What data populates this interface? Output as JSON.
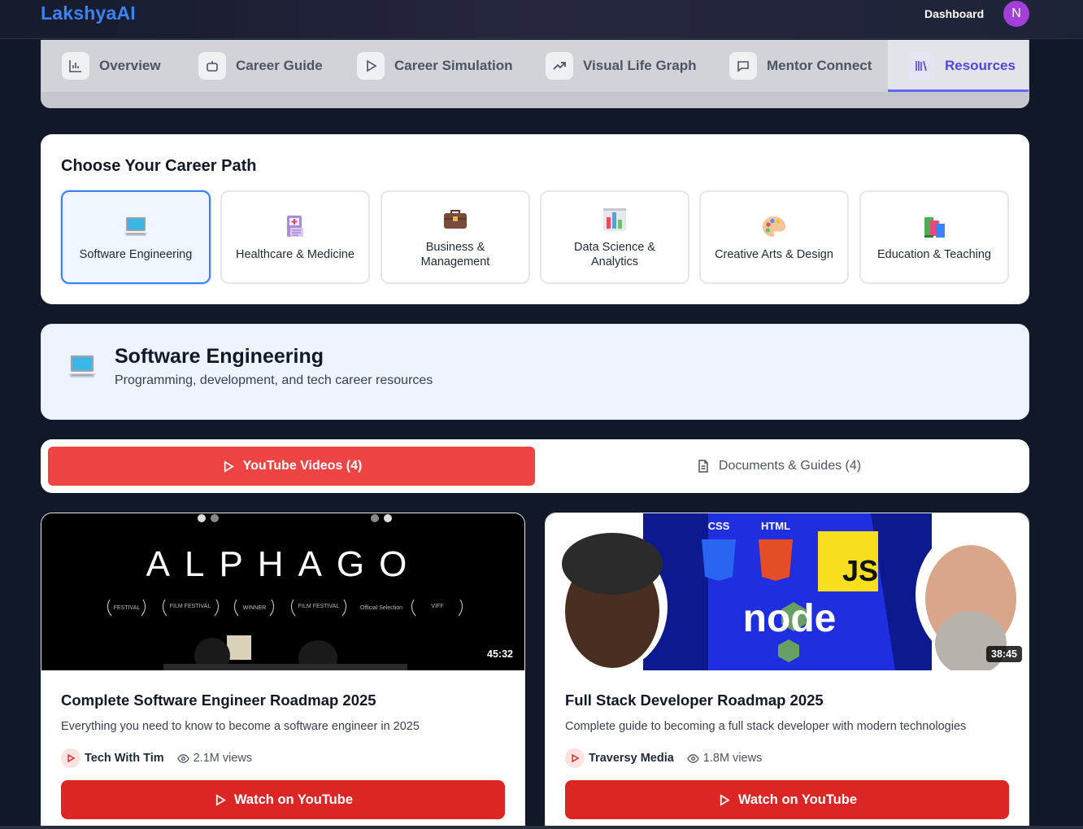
{
  "app": {
    "logo": "LakshyaAI",
    "dashboard_label": "Dashboard",
    "avatar_initial": "N"
  },
  "nav_tabs": [
    {
      "label": "Overview",
      "icon": "bar-chart-icon"
    },
    {
      "label": "Career Guide",
      "icon": "bot-icon"
    },
    {
      "label": "Career Simulation",
      "icon": "play-icon"
    },
    {
      "label": "Visual Life Graph",
      "icon": "trending-up-icon"
    },
    {
      "label": "Mentor Connect",
      "icon": "message-square-icon"
    },
    {
      "label": "Resources",
      "icon": "library-icon",
      "active": true
    }
  ],
  "career_paths": {
    "title": "Choose Your Career Path",
    "items": [
      {
        "label": "Software Engineering",
        "icon": "laptop-icon",
        "selected": true
      },
      {
        "label": "Healthcare & Medicine",
        "icon": "medical-chart-icon"
      },
      {
        "label": "Business & Management",
        "icon": "briefcase-icon"
      },
      {
        "label": "Data Science & Analytics",
        "icon": "bar-chart-emoji-icon"
      },
      {
        "label": "Creative Arts & Design",
        "icon": "palette-icon"
      },
      {
        "label": "Education & Teaching",
        "icon": "books-icon"
      }
    ]
  },
  "selected_path": {
    "title": "Software Engineering",
    "subtitle": "Programming, development, and tech career resources"
  },
  "resource_tabs": {
    "youtube_label": "YouTube Videos (4)",
    "docs_label": "Documents & Guides (4)"
  },
  "videos": [
    {
      "thumb_title": "ALPHAGO",
      "duration": "45:32",
      "title": "Complete Software Engineer Roadmap 2025",
      "description": "Everything you need to know to become a software engineer in 2025",
      "channel": "Tech With Tim",
      "views": "2.1M views",
      "button": "Watch on YouTube"
    },
    {
      "thumb_labels": {
        "css": "CSS",
        "html": "HTML",
        "js": "JS",
        "node": "node"
      },
      "duration": "38:45",
      "title": "Full Stack Developer Roadmap 2025",
      "description": "Complete guide to becoming a full stack developer with modern technologies",
      "channel": "Traversy Media",
      "views": "1.8M views",
      "button": "Watch on YouTube"
    }
  ],
  "colors": {
    "brand_blue": "#3b82f6",
    "active_indigo": "#4f46e5",
    "youtube_red": "#ef4444",
    "watch_red": "#dc2626",
    "avatar_purple": "#a23fd9"
  }
}
